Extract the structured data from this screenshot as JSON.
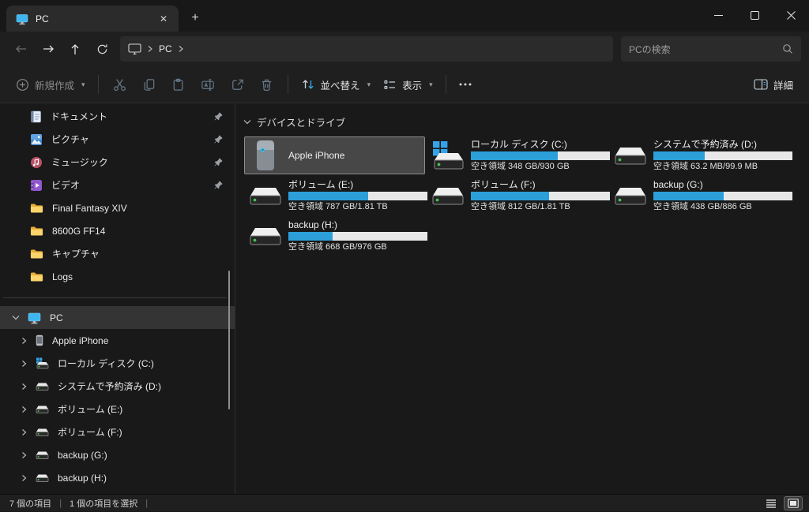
{
  "window": {
    "tab_title": "PC",
    "controls": {
      "minimize": "minimize",
      "maximize": "maximize",
      "close": "close"
    },
    "new_tab_glyph": "+",
    "tab_close_glyph": "✕"
  },
  "nav": {
    "breadcrumb_item": "PC",
    "search_placeholder": "PCの検索"
  },
  "toolbar": {
    "new_label": "新規作成",
    "sort_label": "並べ替え",
    "view_label": "表示",
    "more_glyph": "…",
    "details_label": "詳細"
  },
  "sidebar": {
    "pinned": [
      {
        "label": "ドキュメント",
        "icon": "documents-icon",
        "pinned": true
      },
      {
        "label": "ピクチャ",
        "icon": "pictures-icon",
        "pinned": true
      },
      {
        "label": "ミュージック",
        "icon": "music-icon",
        "pinned": true
      },
      {
        "label": "ビデオ",
        "icon": "videos-icon",
        "pinned": true
      },
      {
        "label": "Final Fantasy XIV",
        "icon": "folder-icon",
        "pinned": false
      },
      {
        "label": "8600G FF14",
        "icon": "folder-icon",
        "pinned": false
      },
      {
        "label": "キャプチャ",
        "icon": "folder-icon",
        "pinned": false
      },
      {
        "label": "Logs",
        "icon": "folder-icon",
        "pinned": false
      }
    ],
    "tree_root": {
      "label": "PC",
      "icon": "monitor-icon",
      "expanded": true,
      "selected": true
    },
    "tree_children": [
      {
        "label": "Apple iPhone",
        "icon": "phone-icon"
      },
      {
        "label": "ローカル ディスク (C:)",
        "icon": "system-drive-icon"
      },
      {
        "label": "システムで予約済み (D:)",
        "icon": "drive-icon"
      },
      {
        "label": "ボリューム (E:)",
        "icon": "drive-icon"
      },
      {
        "label": "ボリューム (F:)",
        "icon": "drive-icon"
      },
      {
        "label": "backup (G:)",
        "icon": "drive-icon"
      },
      {
        "label": "backup (H:)",
        "icon": "drive-icon"
      }
    ]
  },
  "main": {
    "section_title": "デバイスとドライブ",
    "drives": [
      {
        "name": "Apple iPhone",
        "icon": "phone-icon",
        "selected": true
      },
      {
        "name": "ローカル ディスク (C:)",
        "icon": "system-drive-icon",
        "free_label": "空き領域 348 GB/930 GB",
        "used_percent": 62.6
      },
      {
        "name": "システムで予約済み (D:)",
        "icon": "drive-icon",
        "free_label": "空き領域 63.2 MB/99.9 MB",
        "used_percent": 36.7
      },
      {
        "name": "ボリューム (E:)",
        "icon": "drive-icon",
        "free_label": "空き領域 787 GB/1.81 TB",
        "used_percent": 57.5
      },
      {
        "name": "ボリューム (F:)",
        "icon": "drive-icon",
        "free_label": "空き領域 812 GB/1.81 TB",
        "used_percent": 56.2
      },
      {
        "name": "backup (G:)",
        "icon": "drive-icon",
        "free_label": "空き領域 438 GB/886 GB",
        "used_percent": 50.6
      },
      {
        "name": "backup (H:)",
        "icon": "drive-icon",
        "free_label": "空き領域 668 GB/976 GB",
        "used_percent": 31.6
      }
    ]
  },
  "statusbar": {
    "items_count": "7 個の項目",
    "selected_count": "1 個の項目を選択",
    "divider": "|"
  },
  "colors": {
    "accent_blue": "#3aa8e0",
    "bar_fill": "#2d9fd8",
    "bar_background": "#e8e8e8",
    "selection_background": "#474747",
    "folder_yellow": "#f6c64d",
    "led_green": "#46c24e"
  }
}
